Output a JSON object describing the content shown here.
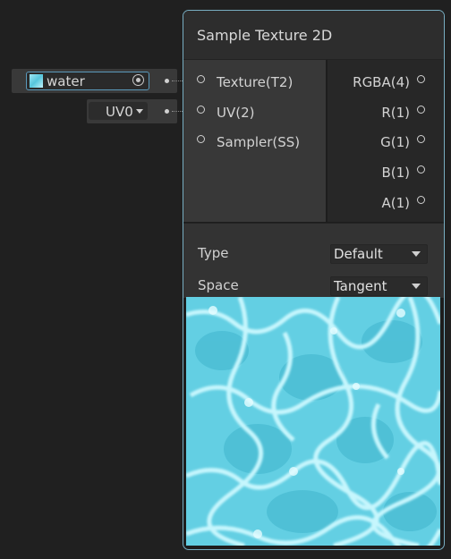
{
  "graph_inputs": {
    "texture": {
      "value": "water",
      "icon": "object-picker-target-icon"
    },
    "uv": {
      "value": "UV0",
      "icon": "chevron-down-icon"
    }
  },
  "node": {
    "title": "Sample Texture 2D",
    "inputs": [
      {
        "label": "Texture(T2)"
      },
      {
        "label": "UV(2)"
      },
      {
        "label": "Sampler(SS)"
      }
    ],
    "outputs": [
      {
        "label": "RGBA(4)"
      },
      {
        "label": "R(1)"
      },
      {
        "label": "G(1)"
      },
      {
        "label": "B(1)"
      },
      {
        "label": "A(1)"
      }
    ],
    "settings": {
      "type": {
        "label": "Type",
        "value": "Default"
      },
      "space": {
        "label": "Space",
        "value": "Tangent"
      }
    },
    "preview": {
      "texture": "water",
      "colors": {
        "base": "#63cfe3",
        "light": "#c6f6fd",
        "deep": "#3fb5cd"
      }
    }
  },
  "colors": {
    "node_border": "#78aec2",
    "canvas": "#202020",
    "field_focus_border": "#5a99bb"
  }
}
